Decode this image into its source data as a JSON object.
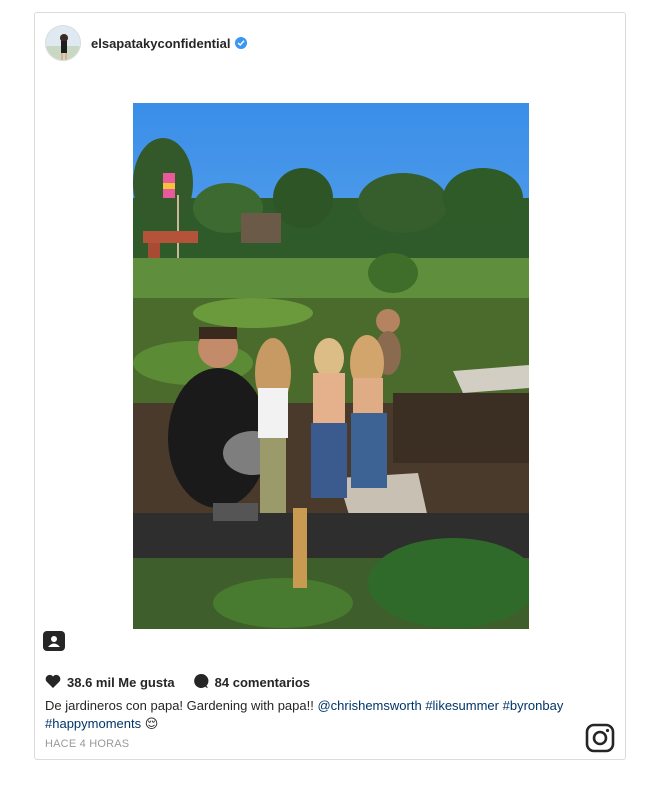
{
  "post": {
    "username": "elsapatakyconfidential",
    "verified": true,
    "likes_text": "38.6 mil Me gusta",
    "comments_text": "84 comentarios",
    "caption_text": "De jardineros con papa! Gardening with papa!! ",
    "caption_mention": "@chrishemsworth",
    "caption_tags": [
      "#likesummer",
      "#byronbay",
      "#happymoments"
    ],
    "caption_emoji": "😌",
    "timestamp": "HACE 4 HORAS"
  },
  "icons": {
    "verified": "verified-badge-icon",
    "heart": "heart-icon",
    "comment": "comment-bubble-icon",
    "user_tag": "user-tag-icon",
    "instagram": "instagram-logo-icon"
  },
  "colors": {
    "verified": "#3897f0",
    "link": "#003569",
    "timestamp": "#999999",
    "border": "#dbdbdb"
  }
}
